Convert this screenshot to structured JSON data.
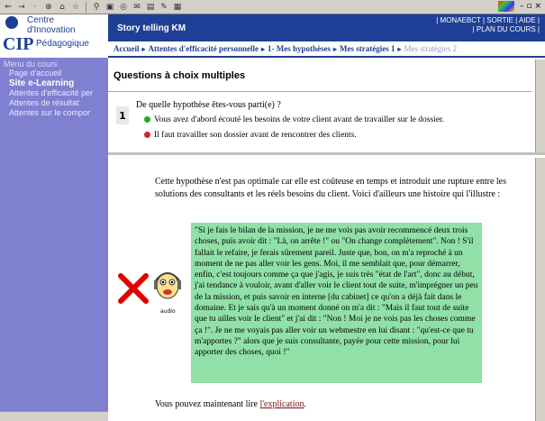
{
  "browser": {
    "toolbar_icons": [
      "back-icon",
      "forward-icon",
      "stop-icon",
      "refresh-icon",
      "home-icon",
      "search-icon",
      "favorites-icon",
      "history-icon",
      "mail-icon",
      "print-icon",
      "edit-icon"
    ],
    "window_controls": "– ▫ ×"
  },
  "header": {
    "logo_lines": [
      "Centre",
      "d'Innovation",
      "Pédagogique"
    ],
    "logo_abbr": "CIP",
    "app_title": "Story telling KM",
    "top_links": [
      "MONAEBCT",
      "SORTIE",
      "AIDE",
      "PLAN DU COURS"
    ]
  },
  "breadcrumb": [
    "Accueil",
    "Attentes d'efficacité personnelle",
    "1- Mes hypothèses",
    "Mes stratégies 1",
    "Mes stratégies 2"
  ],
  "sidebar": {
    "title": "Menu du cours",
    "items": [
      {
        "label": "Page d'accueil",
        "bold": false
      },
      {
        "label": "Site e-Learning",
        "bold": true
      },
      {
        "label": "Attentes d'efficacité per",
        "bold": false
      },
      {
        "label": "Attentes de résultat",
        "bold": false
      },
      {
        "label": "Attentes sur le compor",
        "bold": false
      }
    ]
  },
  "question": {
    "section_title": "Questions à choix multiples",
    "number": "1",
    "prompt": "De quelle hypothèse êtes-vous parti(e) ?",
    "options": [
      {
        "text": "Vous avez d'abord écouté les besoins de votre client avant de travailler sur le dossier.",
        "color": "#22aa22"
      },
      {
        "text": "Il faut travailler son dossier avant de rencontrer des clients.",
        "color": "#dd2222"
      }
    ]
  },
  "answer": {
    "explanation": "Cette hypothèse n'est pas optimale car elle est coûteuse en temps et introduit une rupture entre les solutions des consultants et les réels besoins du client. Voici d'ailleurs une histoire qui l'illustre :",
    "quote": "\"Si je fais le bilan de la mission, je ne me vois pas avoir recommencé deux trois choses, puis avoir dit : \"Là, on arrête !\" ou \"On change complètement\". Non ! S'il fallait le refaire, je ferais sûrement pareil. Juste que, bon, on m'a reproché à un moment de ne pas aller voir les gens. Moi, il me semblait que, pour démarrer, enfin, c'est toujours comme ça que j'agis, je suis très \"état de l'art\", donc au début, j'ai tendance à vouloir, avant d'aller voir le client tout de suite, m'imprégner un peu de la mission, et puis savoir en interne [du cabinet] ce qu'on a déjà fait dans le domaine. Et je sais qu'à un moment donné on m'a dit : \"Mais il faut tout de suite que tu ailles voir le client\" et j'ai dit : \"Non ! Moi je ne vois pas les choses comme ça !\". Je ne me voyais pas aller voir un webmestre en lui disant : \"qu'est-ce que tu m'apportes ?\" alors que je suis consultante, payée pour cette mission, pour lui apporter des choses, quoi !\"",
    "audio_label": "audio",
    "more_prefix": "Vous pouvez maintenant lire ",
    "more_link": "l'explication",
    "more_suffix": "."
  }
}
